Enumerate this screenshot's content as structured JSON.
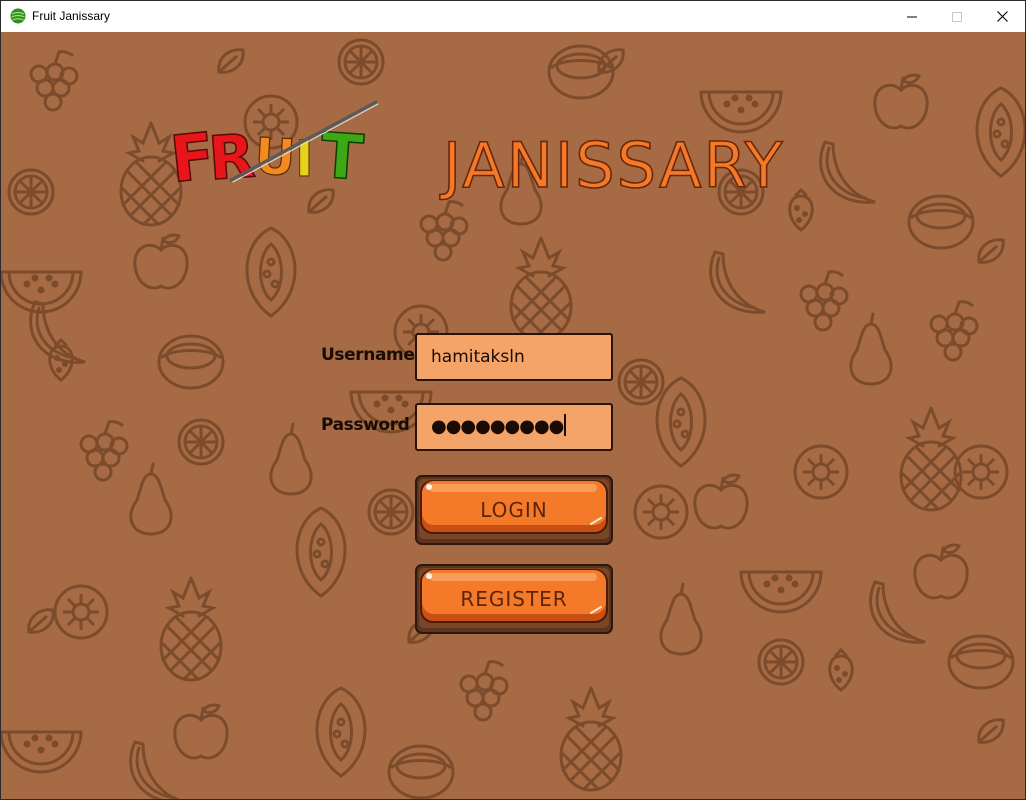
{
  "window": {
    "title": "Fruit Janissary",
    "controls": {
      "minimize": "minimize",
      "maximize": "maximize",
      "close": "close"
    }
  },
  "logo": {
    "word1": "FRUIT",
    "word2": "JANISSARY",
    "colors": {
      "red": "#e8151b",
      "orange": "#f28a1e",
      "yellow": "#e8d11a",
      "green": "#3ca816",
      "janissary": "#f47a2a"
    }
  },
  "form": {
    "username_label": "Username",
    "username_value": "hamitaksln",
    "password_label": "Password",
    "password_masked": "●●●●●●●●●"
  },
  "buttons": {
    "login": "LOGIN",
    "register": "REGISTER"
  },
  "theme": {
    "background": "#a66b45",
    "pattern_line": "#7a4a2c",
    "input_fill": "#f4a468",
    "button_orange": "#f47a2a",
    "button_frame": "#6b3a22"
  }
}
